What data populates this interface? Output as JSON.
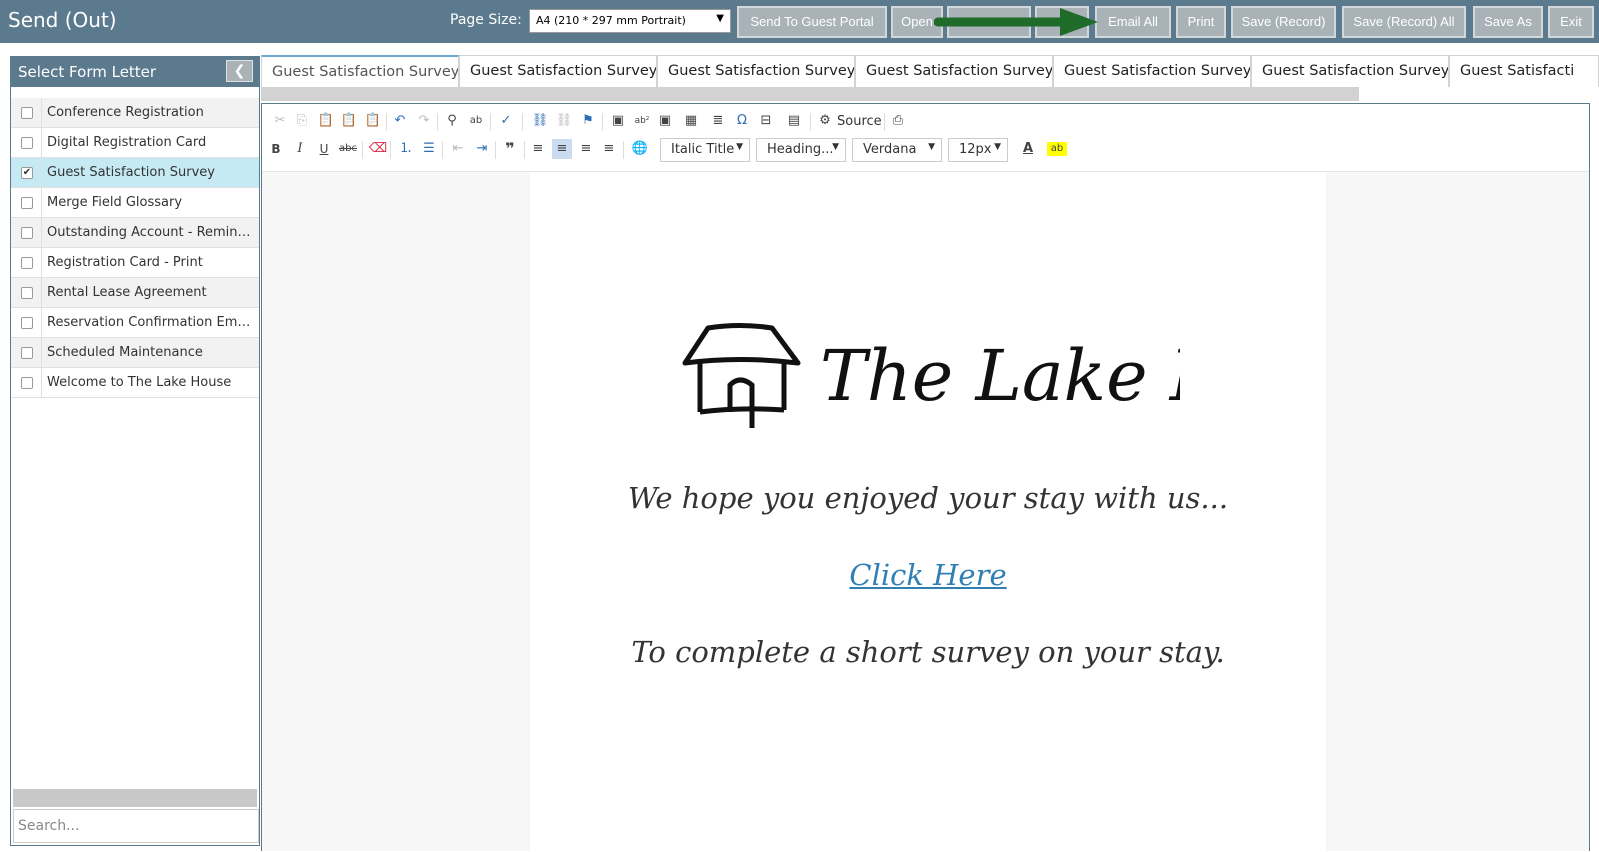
{
  "app": {
    "title": "Send (Out)"
  },
  "page_size": {
    "label": "Page Size:",
    "value": "A4 (210 * 297 mm Portrait)"
  },
  "toolbar_buttons": {
    "send_to_guest_portal": "Send To Guest Portal",
    "open": "Open",
    "email_all": "Email All",
    "print": "Print",
    "save_record": "Save (Record)",
    "save_record_all": "Save (Record) All",
    "save_as": "Save As",
    "exit": "Exit"
  },
  "sidebar": {
    "title": "Select Form Letter",
    "collapse_icon": "chevron-left-icon",
    "items": [
      {
        "label": "Conference Registration",
        "checked": false
      },
      {
        "label": "Digital Registration Card",
        "checked": false
      },
      {
        "label": "Guest Satisfaction Survey",
        "checked": true
      },
      {
        "label": "Merge Field Glossary",
        "checked": false
      },
      {
        "label": "Outstanding Account - Reminde...",
        "checked": false
      },
      {
        "label": "Registration Card - Print",
        "checked": false
      },
      {
        "label": "Rental Lease Agreement",
        "checked": false
      },
      {
        "label": "Reservation Confirmation Email",
        "checked": false
      },
      {
        "label": "Scheduled Maintenance",
        "checked": false
      },
      {
        "label": "Welcome to The Lake House",
        "checked": false
      }
    ],
    "search_placeholder": "Search..."
  },
  "tabs": [
    "Guest Satisfaction Survey",
    "Guest Satisfaction Survey",
    "Guest Satisfaction Survey",
    "Guest Satisfaction Survey",
    "Guest Satisfaction Survey",
    "Guest Satisfaction Survey",
    "Guest Satisfacti"
  ],
  "editor": {
    "source_label": "Source",
    "format_combo": "Italic Title",
    "heading_combo": "Heading...",
    "font_combo": "Verdana",
    "size_combo": "12px"
  },
  "document": {
    "logo_text": "The Lake House.",
    "line1": "We hope you enjoyed your stay with us...",
    "link_text": "Click Here",
    "line3": "To complete a short survey on your stay."
  },
  "colors": {
    "header": "#5b7a8e",
    "button": "#a9b2b7",
    "selected_row": "#c5eaf4",
    "arrow": "#1e6b2a",
    "link": "#2f7fb5"
  }
}
